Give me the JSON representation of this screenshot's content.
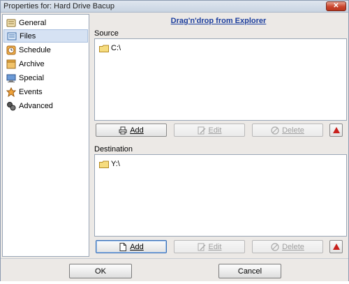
{
  "window": {
    "title": "Properties for: Hard Drive Bacup",
    "close_glyph": "✕"
  },
  "sidebar": {
    "items": [
      {
        "label": "General",
        "icon": "general-icon",
        "selected": false
      },
      {
        "label": "Files",
        "icon": "files-icon",
        "selected": true
      },
      {
        "label": "Schedule",
        "icon": "schedule-icon",
        "selected": false
      },
      {
        "label": "Archive",
        "icon": "archive-icon",
        "selected": false
      },
      {
        "label": "Special",
        "icon": "special-icon",
        "selected": false
      },
      {
        "label": "Events",
        "icon": "events-icon",
        "selected": false
      },
      {
        "label": "Advanced",
        "icon": "advanced-icon",
        "selected": false
      }
    ]
  },
  "main": {
    "drag_title": "Drag'n'drop from Explorer",
    "source": {
      "label": "Source",
      "items": [
        "C:\\"
      ],
      "add_label": "Add",
      "edit_label": "Edit",
      "delete_label": "Delete"
    },
    "destination": {
      "label": "Destination",
      "items": [
        "Y:\\"
      ],
      "add_label": "Add",
      "edit_label": "Edit",
      "delete_label": "Delete"
    }
  },
  "footer": {
    "ok_label": "OK",
    "cancel_label": "Cancel"
  },
  "colors": {
    "link": "#1d3f9e",
    "selection": "#d6e2f3",
    "up_arrow": "#c8201c"
  }
}
